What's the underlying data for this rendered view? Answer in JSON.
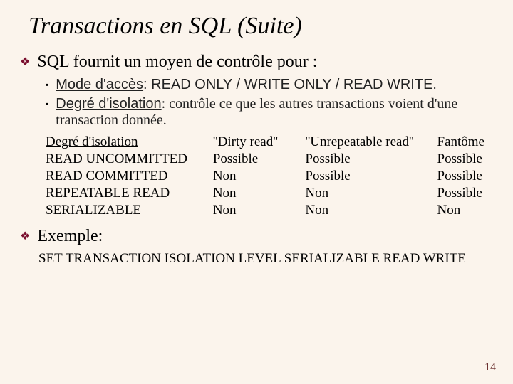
{
  "title": "Transactions en SQL (Suite)",
  "b1": "SQL fournit un moyen de contrôle pour :",
  "sub1_label": "Mode d'accès",
  "sub1_rest": ": READ ONLY / WRITE ONLY / READ WRITE.",
  "sub2_label": "Degré d'isolation",
  "sub2_rest": ": contrôle ce que les autres transactions voient d'une transaction donnée.",
  "table": {
    "h_level": " Degré d'isolation",
    "h_dirty": "''Dirty read''",
    "h_unrep": "''Unrepeatable read''",
    "h_phantom": "Fantôme",
    "rows": [
      {
        "level": "READ UNCOMMITTED",
        "dirty": "Possible",
        "unrep": "Possible",
        "phantom": "Possible"
      },
      {
        "level": "READ COMMITTED",
        "dirty": "Non",
        "unrep": "Possible",
        "phantom": "Possible"
      },
      {
        "level": "REPEATABLE READ",
        "dirty": "Non",
        "unrep": "Non",
        "phantom": "Possible"
      },
      {
        "level": "SERIALIZABLE",
        "dirty": "Non",
        "unrep": "Non",
        "phantom": "Non"
      }
    ]
  },
  "b2": "Exemple:",
  "example_code": "SET TRANSACTION ISOLATION LEVEL  SERIALIZABLE READ WRITE",
  "page_number": "14",
  "chart_data": {
    "type": "table",
    "title": "Degré d'isolation vs anomalies",
    "columns": [
      "Degré d'isolation",
      "''Dirty read''",
      "''Unrepeatable read''",
      "Fantôme"
    ],
    "rows": [
      [
        "READ UNCOMMITTED",
        "Possible",
        "Possible",
        "Possible"
      ],
      [
        "READ COMMITTED",
        "Non",
        "Possible",
        "Possible"
      ],
      [
        "REPEATABLE READ",
        "Non",
        "Non",
        "Possible"
      ],
      [
        "SERIALIZABLE",
        "Non",
        "Non",
        "Non"
      ]
    ]
  }
}
